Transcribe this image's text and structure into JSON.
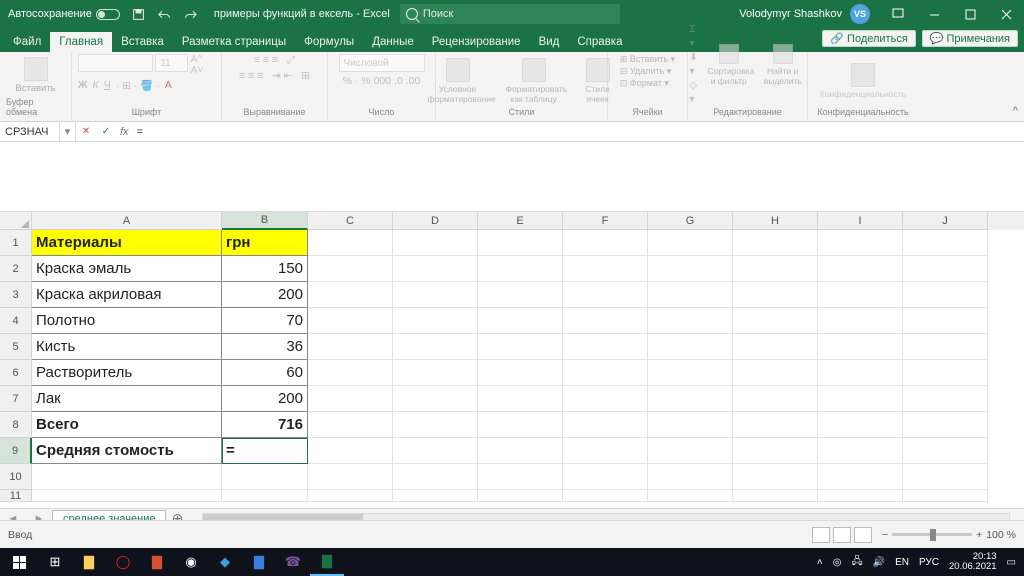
{
  "titlebar": {
    "autosave": "Автосохранение",
    "title_doc": "примеры функций в ексель",
    "title_app": "Excel",
    "search_placeholder": "Поиск",
    "user": "Volodymyr Shashkov",
    "user_initials": "VS"
  },
  "tabs": {
    "file": "Файл",
    "home": "Главная",
    "insert": "Вставка",
    "layout": "Разметка страницы",
    "formulas": "Формулы",
    "data": "Данные",
    "review": "Рецензирование",
    "view": "Вид",
    "help": "Справка",
    "share": "Поделиться",
    "comments": "Примечания"
  },
  "ribbon": {
    "clipboard_btn": "Вставить",
    "clipboard": "Буфер обмена",
    "font_name": "",
    "font_sz": "11",
    "font": "Шрифт",
    "align": "Выравнивание",
    "numfmt_sel": "Числовой",
    "number": "Число",
    "cond": "Условное форматирование",
    "astable": "Форматировать как таблицу",
    "cellstyles": "Стили ячеек",
    "styles": "Стили",
    "ins": "Вставить",
    "del": "Удалить",
    "fmt": "Формат",
    "cells": "Ячейки",
    "sort": "Сортировка и фильтр",
    "find": "Найти и выделить",
    "editing": "Редактирование",
    "conf": "Конфиденциальность",
    "conf_grp": "Конфиденциальность"
  },
  "fx": {
    "name": "СРЗНАЧ",
    "formula": "="
  },
  "sheet": {
    "cols": [
      "A",
      "B",
      "C",
      "D",
      "E",
      "F",
      "G",
      "H",
      "I",
      "J"
    ],
    "header": {
      "a": "Материалы",
      "b": "грн"
    },
    "rows": [
      {
        "a": "Краска эмаль",
        "b": "150"
      },
      {
        "a": "Краска акриловая",
        "b": "200"
      },
      {
        "a": "Полотно",
        "b": "70"
      },
      {
        "a": "Кисть",
        "b": "36"
      },
      {
        "a": "Растворитель",
        "b": "60"
      },
      {
        "a": "Лак",
        "b": "200"
      }
    ],
    "total": {
      "a": "Всего",
      "b": "716"
    },
    "avg": {
      "a": "Средняя стомость",
      "b": "="
    },
    "tabname": "среднее значение"
  },
  "status": {
    "mode": "Ввод",
    "zoom": "100 %"
  },
  "tray": {
    "lang1": "EN",
    "lang2": "РУС",
    "time": "20:13",
    "date": "20.06.2021"
  }
}
